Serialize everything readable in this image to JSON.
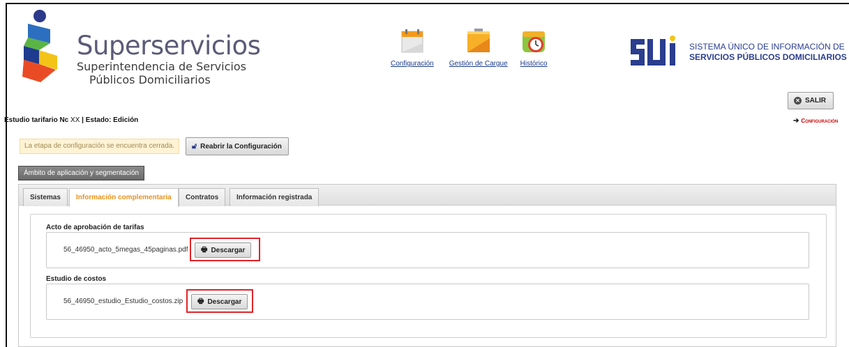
{
  "brand": {
    "name": "Superservicios",
    "subtitle_line1": "Superintendencia de Servicios",
    "subtitle_line2": "Públicos Domiciliarios"
  },
  "topnav": [
    {
      "label": "Configuración",
      "icon": "calendar-icon"
    },
    {
      "label": "Gestión de Cargue",
      "icon": "folder-icon"
    },
    {
      "label": "Histórico",
      "icon": "clock-icon"
    }
  ],
  "sui": {
    "line1": "SISTEMA ÚNICO DE INFORMACIÓN DE",
    "line2": "SERVICIOS PÚBLICOS DOMICILIARIOS"
  },
  "header": {
    "salir_label": "SALIR",
    "estudio_prefix": "Estudio tarifario Nc",
    "estudio_xx": "XX",
    "estudio_suffix": " | Estado: Edición",
    "config_link": "Configuración"
  },
  "status": {
    "closed_message": "La etapa de configuración se encuentra cerrada.",
    "reopen_label": "Reabrir la Configuración"
  },
  "ambito_label": "Ámbito de aplicación y segmentación",
  "tabs": [
    {
      "label": "Sistemas",
      "active": false
    },
    {
      "label": "Información complementaria",
      "active": true
    },
    {
      "label": "Contratos",
      "active": false
    },
    {
      "label": "Información registrada",
      "active": false
    }
  ],
  "sections": [
    {
      "title": "Acto de aprobación de tarifas",
      "file": "56_46950_acto_5megas_45paginas.pdf",
      "button": "Descargar"
    },
    {
      "title": "Estudio de costos",
      "file": "56_46950_estudio_Estudio_costos.zip",
      "button": "Descargar"
    }
  ],
  "colors": {
    "accent_orange": "#e8921c",
    "brand_text": "#5b5b78",
    "sui_blue": "#2a3d8f",
    "highlight_red": "#e0242a"
  }
}
